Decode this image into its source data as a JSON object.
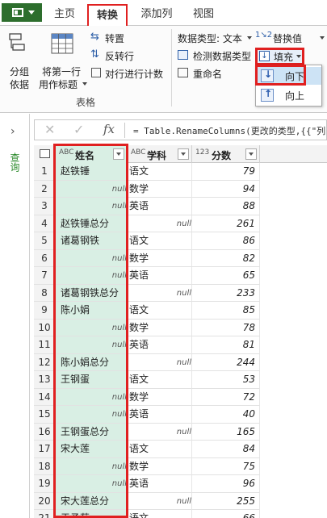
{
  "tabs": [
    "主页",
    "转换",
    "添加列",
    "视图"
  ],
  "ribbon": {
    "group_by": [
      "分组",
      "依据"
    ],
    "use_first_row": [
      "将第一行",
      "用作标题"
    ],
    "transpose": "转置",
    "reverse_rows": "反转行",
    "count_rows": "对行进行计数",
    "group_title": "表格",
    "data_type": "数据类型: 文本",
    "detect_type": "检测数据类型",
    "rename": "重命名",
    "replace_values": "替换值",
    "fill": "填充"
  },
  "fill_menu": {
    "down": "向下",
    "up": "向上"
  },
  "left_pane": {
    "query_label": "查询"
  },
  "formula": {
    "cancel": "✕",
    "commit": "✓",
    "fx": "fx",
    "text": "= Table.RenameColumns(更改的类型,{{\"列"
  },
  "columns": [
    {
      "type": "ABC",
      "name": "姓名"
    },
    {
      "type": "ABC",
      "name": "学科"
    },
    {
      "type": "123",
      "name": "分数"
    }
  ],
  "rows": [
    {
      "n": "1",
      "name": "赵铁锤",
      "subject": "语文",
      "score": "79"
    },
    {
      "n": "2",
      "name": "null",
      "subject": "数学",
      "score": "94"
    },
    {
      "n": "3",
      "name": "null",
      "subject": "英语",
      "score": "88"
    },
    {
      "n": "4",
      "name": "赵铁锤总分",
      "subject": "null",
      "score": "261"
    },
    {
      "n": "5",
      "name": "诸葛钢铁",
      "subject": "语文",
      "score": "86"
    },
    {
      "n": "6",
      "name": "null",
      "subject": "数学",
      "score": "82"
    },
    {
      "n": "7",
      "name": "null",
      "subject": "英语",
      "score": "65"
    },
    {
      "n": "8",
      "name": "诸葛钢铁总分",
      "subject": "null",
      "score": "233"
    },
    {
      "n": "9",
      "name": "陈小娟",
      "subject": "语文",
      "score": "85"
    },
    {
      "n": "10",
      "name": "null",
      "subject": "数学",
      "score": "78"
    },
    {
      "n": "11",
      "name": "null",
      "subject": "英语",
      "score": "81"
    },
    {
      "n": "12",
      "name": "陈小娟总分",
      "subject": "null",
      "score": "244"
    },
    {
      "n": "13",
      "name": "王钢蛋",
      "subject": "语文",
      "score": "53"
    },
    {
      "n": "14",
      "name": "null",
      "subject": "数学",
      "score": "72"
    },
    {
      "n": "15",
      "name": "null",
      "subject": "英语",
      "score": "40"
    },
    {
      "n": "16",
      "name": "王钢蛋总分",
      "subject": "null",
      "score": "165"
    },
    {
      "n": "17",
      "name": "宋大莲",
      "subject": "语文",
      "score": "84"
    },
    {
      "n": "18",
      "name": "null",
      "subject": "数学",
      "score": "75"
    },
    {
      "n": "19",
      "name": "null",
      "subject": "英语",
      "score": "96"
    },
    {
      "n": "20",
      "name": "宋大莲总分",
      "subject": "null",
      "score": "255"
    },
    {
      "n": "21",
      "name": "于予菊",
      "subject": "语文",
      "score": "66"
    }
  ],
  "colors": {
    "accent": "#e02020",
    "file": "#2d6e2d",
    "name_col": "#d9efe4"
  }
}
